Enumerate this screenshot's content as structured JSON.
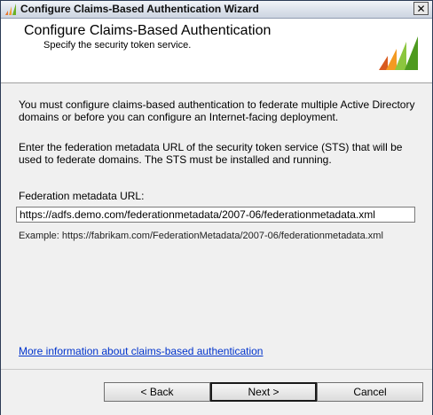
{
  "window": {
    "title": "Configure Claims-Based Authentication Wizard",
    "close_label": "✕"
  },
  "header": {
    "title": "Configure Claims-Based Authentication",
    "subtitle": "Specify the security token service."
  },
  "main": {
    "para1": "You must configure claims-based authentication to federate multiple Active Directory domains or before you can configure an Internet-facing deployment.",
    "para2": "Enter the federation metadata URL of the security token service (STS) that will be used to federate domains. The STS must be installed and running.",
    "url_label": "Federation metadata URL:",
    "url_value": "https://adfs.demo.com/federationmetadata/2007-06/federationmetadata.xml",
    "example": "Example: https://fabrikam.com/FederationMetadata/2007-06/federationmetadata.xml",
    "more_link": "More information about claims-based authentication"
  },
  "footer": {
    "back_label": "< Back",
    "next_label": "Next >",
    "cancel_label": "Cancel"
  },
  "colors": {
    "link": "#0033cc",
    "logo_orange": "#e8722a",
    "logo_green": "#6ab023"
  }
}
